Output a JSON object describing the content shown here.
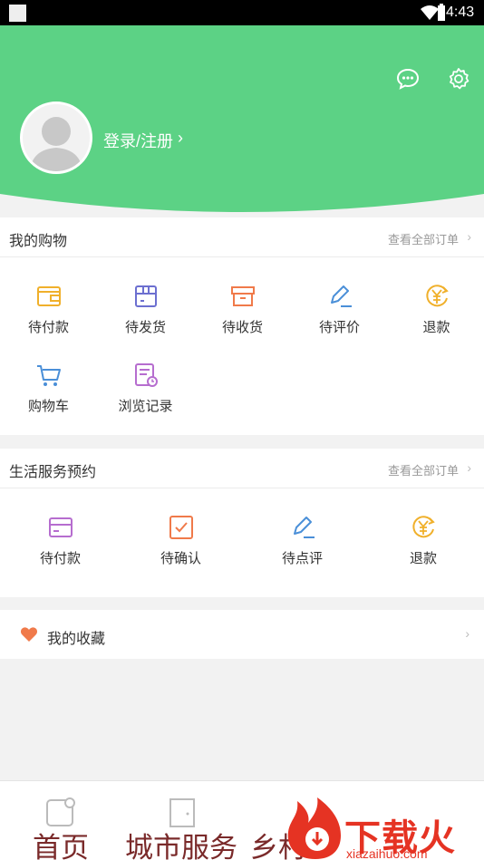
{
  "status_bar": {
    "time": "4:43"
  },
  "header": {
    "login_label": "登录/注册",
    "chevron": "›",
    "message_icon": "chat-bubble-icon",
    "settings_icon": "gear-icon",
    "accent_color": "#5cd285"
  },
  "shopping": {
    "title": "我的购物",
    "view_all": "查看全部订单",
    "chevron": "›",
    "items": [
      {
        "label": "待付款",
        "icon": "wallet-icon"
      },
      {
        "label": "待发货",
        "icon": "box-icon"
      },
      {
        "label": "待收货",
        "icon": "package-icon"
      },
      {
        "label": "待评价",
        "icon": "pen-icon"
      },
      {
        "label": "退款",
        "icon": "yen-refund-icon"
      },
      {
        "label": "购物车",
        "icon": "cart-icon"
      },
      {
        "label": "浏览记录",
        "icon": "history-icon"
      }
    ]
  },
  "services": {
    "title": "生活服务预约",
    "view_all": "查看全部订单",
    "chevron": "›",
    "items": [
      {
        "label": "待付款",
        "icon": "card-icon"
      },
      {
        "label": "待确认",
        "icon": "checkbox-icon"
      },
      {
        "label": "待点评",
        "icon": "pen-icon"
      },
      {
        "label": "退款",
        "icon": "yen-refund-icon"
      }
    ]
  },
  "favorites": {
    "label": "我的收藏",
    "chevron": "›"
  },
  "tabbar": {
    "tabs": [
      {
        "label": "首页",
        "icon": "home-icon"
      },
      {
        "label": "城市服务",
        "icon": "door-icon"
      },
      {
        "label": "乡村",
        "icon": ""
      }
    ]
  },
  "watermark": {
    "brand": "下载火",
    "url": "xiazaihuo.com"
  }
}
